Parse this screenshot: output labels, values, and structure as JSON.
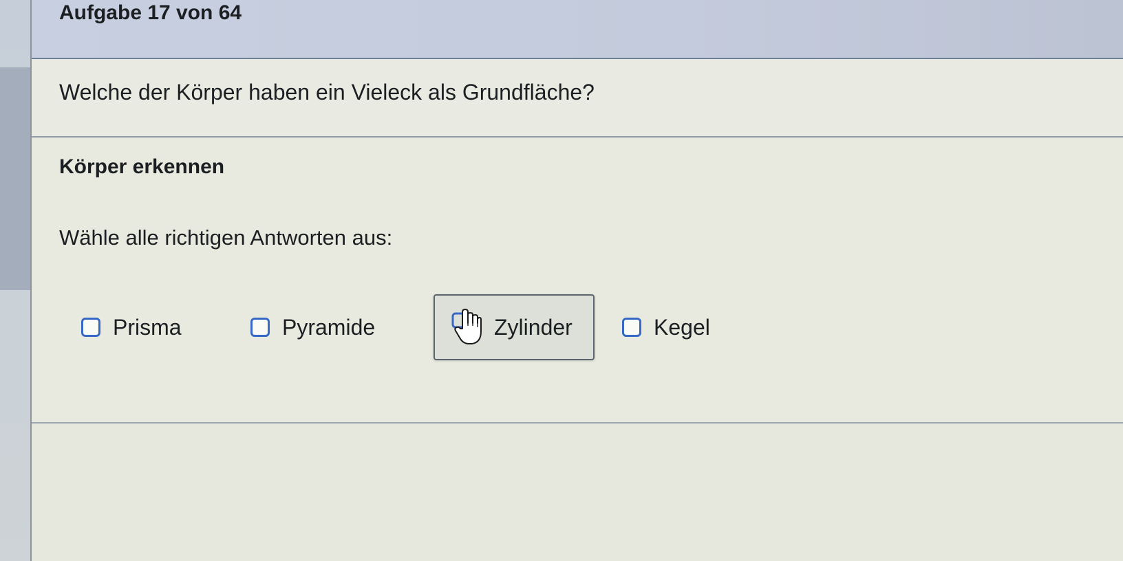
{
  "header": {
    "task_counter": "Aufgabe 17 von 64"
  },
  "question": {
    "text": "Welche der Körper haben ein Vieleck als Grundfläche?"
  },
  "content": {
    "topic_title": "Körper erkennen",
    "instruction": "Wähle alle richtigen Antworten aus:",
    "options": [
      {
        "label": "Prisma",
        "checked": false,
        "icon": "checkbox-icon"
      },
      {
        "label": "Pyramide",
        "checked": false,
        "icon": "checkbox-icon"
      },
      {
        "label": "Zylinder",
        "checked": false,
        "hovered": true,
        "icon": "hand-pointer-icon"
      },
      {
        "label": "Kegel",
        "checked": false,
        "icon": "checkbox-icon"
      }
    ]
  },
  "colors": {
    "checkbox_border": "#3768c8",
    "header_background": "#c7cfe0"
  }
}
